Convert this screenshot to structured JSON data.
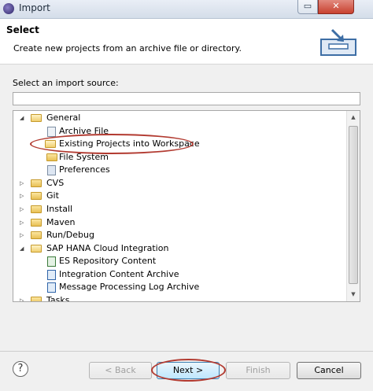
{
  "window": {
    "title": "Import",
    "maximize_glyph": "▭",
    "close_glyph": "✕"
  },
  "header": {
    "title": "Select",
    "description": "Create new projects from an archive file or directory.",
    "icon": "import-wizard-icon"
  },
  "source": {
    "label": "Select an import source:",
    "filter_value": ""
  },
  "tree": {
    "items": [
      {
        "label": "General",
        "icon": "folder-open-icon",
        "twisty": "expanded"
      },
      {
        "label": "Archive File",
        "icon": "archive-file-icon"
      },
      {
        "label": "Existing Projects into Workspace",
        "icon": "folder-project-icon",
        "highlighted": true
      },
      {
        "label": "File System",
        "icon": "folder-icon"
      },
      {
        "label": "Preferences",
        "icon": "preferences-icon"
      },
      {
        "label": "CVS",
        "icon": "folder-icon",
        "twisty": "collapsed"
      },
      {
        "label": "Git",
        "icon": "folder-icon",
        "twisty": "collapsed"
      },
      {
        "label": "Install",
        "icon": "folder-icon",
        "twisty": "collapsed"
      },
      {
        "label": "Maven",
        "icon": "folder-icon",
        "twisty": "collapsed"
      },
      {
        "label": "Run/Debug",
        "icon": "folder-icon",
        "twisty": "collapsed"
      },
      {
        "label": "SAP HANA Cloud Integration",
        "icon": "folder-open-icon",
        "twisty": "expanded"
      },
      {
        "label": "ES Repository Content",
        "icon": "es-repository-icon"
      },
      {
        "label": "Integration Content Archive",
        "icon": "integration-archive-icon"
      },
      {
        "label": "Message Processing Log Archive",
        "icon": "mpl-archive-icon"
      },
      {
        "label": "Tasks",
        "icon": "folder-icon",
        "twisty": "collapsed"
      }
    ]
  },
  "buttons": {
    "help": "?",
    "back": "< Back",
    "next": "Next >",
    "finish": "Finish",
    "cancel": "Cancel"
  },
  "colors": {
    "highlight_ring": "#b23a30",
    "default_button": "#bee6fd"
  }
}
